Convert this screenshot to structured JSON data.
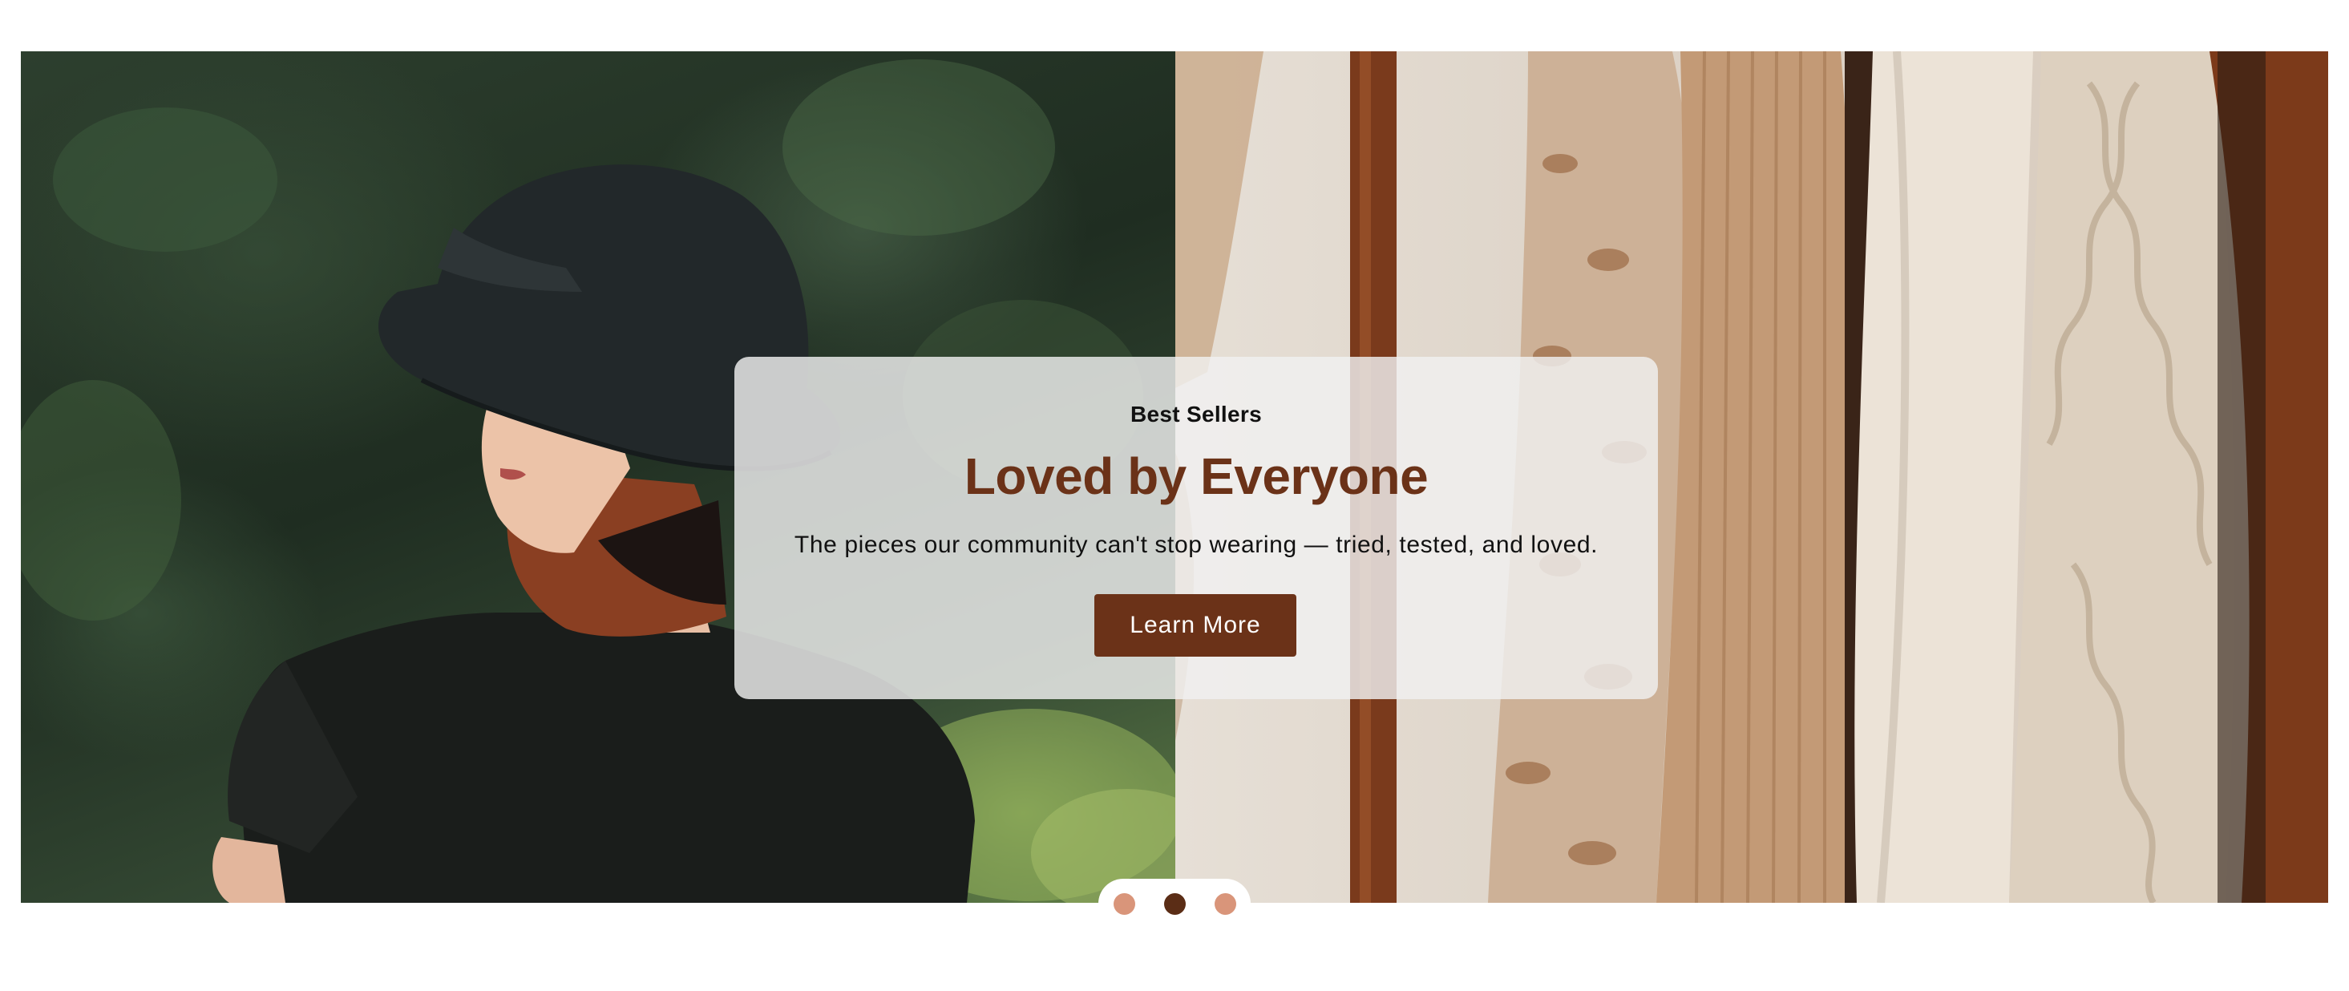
{
  "hero": {
    "eyebrow": "Best Sellers",
    "headline": "Loved by Everyone",
    "subtext": "The pieces our community can't stop wearing — tried, tested, and loved.",
    "cta_label": "Learn More",
    "left_image_alt": "Woman in black bucket hat and black top",
    "right_image_alt": "Knit sweaters and blouses hanging on a rack"
  },
  "carousel": {
    "slide_count": 3,
    "active_index": 1
  },
  "colors": {
    "accent": "#6b3218",
    "dot_inactive": "#d9957a",
    "dot_active": "#5b2d16"
  }
}
